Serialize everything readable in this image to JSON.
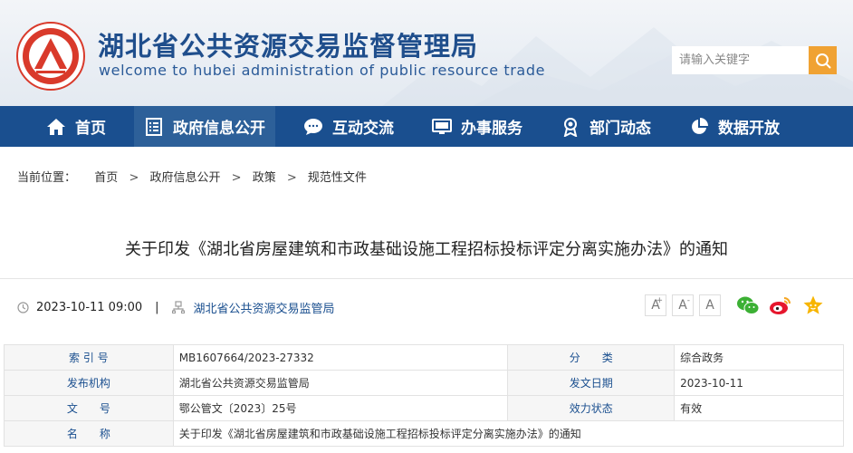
{
  "header": {
    "title": "湖北省公共资源交易监督管理局",
    "subtitle": "welcome to hubei administration of public resource trade",
    "logo_icon": "hubei-emblem-icon",
    "search": {
      "placeholder": "请输入关键字",
      "button_icon": "search-icon"
    },
    "colors": {
      "brand": "#1f4e8c",
      "search_button": "#f0a233"
    }
  },
  "nav": {
    "items": [
      {
        "label": "首页",
        "icon": "home-icon"
      },
      {
        "label": "政府信息公开",
        "icon": "document-list-icon",
        "active": true
      },
      {
        "label": "互动交流",
        "icon": "chat-bubble-icon"
      },
      {
        "label": "办事服务",
        "icon": "monitor-icon"
      },
      {
        "label": "部门动态",
        "icon": "badge-icon"
      },
      {
        "label": "数据开放",
        "icon": "pie-chart-icon"
      }
    ],
    "colors": {
      "background": "#1a4f8f",
      "active": "#2d6099"
    }
  },
  "breadcrumb": {
    "prefix": "当前位置：",
    "items": [
      "首页",
      "政府信息公开",
      "政策",
      "规范性文件"
    ],
    "separator": ">"
  },
  "article": {
    "title": "关于印发《湖北省房屋建筑和市政基础设施工程招标投标评定分离实施办法》的通知",
    "datetime": "2023-10-11 09:00",
    "divider": "|",
    "publisher": "湖北省公共资源交易监管局",
    "font_sizes": [
      {
        "label": "A",
        "mark": "+"
      },
      {
        "label": "A",
        "mark": "-"
      },
      {
        "label": "A",
        "mark": ""
      }
    ],
    "share_icons": [
      "wechat-icon",
      "weibo-icon",
      "favorite-star-icon"
    ]
  },
  "info_table": {
    "rows": [
      {
        "k1": "索 引 号",
        "v1": "MB1607664/2023-27332",
        "k2": "分　　类",
        "v2": "综合政务"
      },
      {
        "k1": "发布机构",
        "v1": "湖北省公共资源交易监管局",
        "k2": "发文日期",
        "v2": "2023-10-11"
      },
      {
        "k1": "文　　号",
        "v1": "鄂公管文〔2023〕25号",
        "k2": "效力状态",
        "v2": "有效"
      }
    ],
    "name_row": {
      "k": "名　　称",
      "v": "关于印发《湖北省房屋建筑和市政基础设施工程招标投标评定分离实施办法》的通知"
    }
  }
}
